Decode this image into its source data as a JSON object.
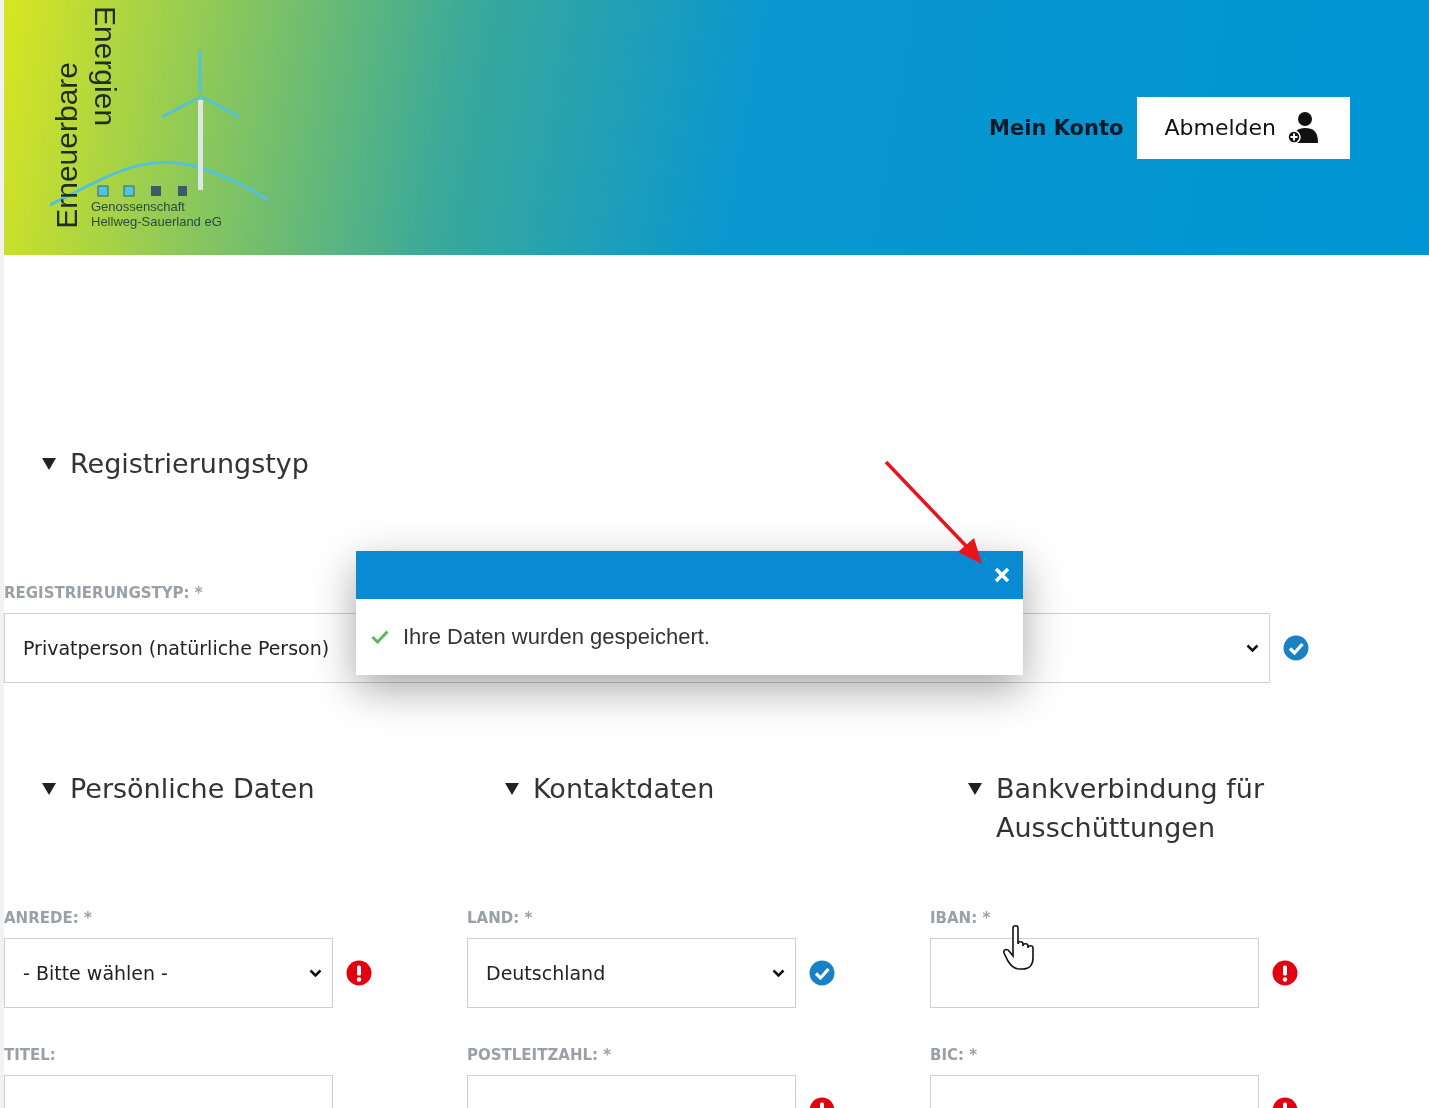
{
  "header": {
    "logo": {
      "line1": "Erneuerbare",
      "line2": "Energien",
      "subtitle_1": "Genossenschaft",
      "subtitle_2": "Hellweg-Sauerland eG"
    },
    "links": [
      {
        "label": "Mein Konto",
        "kind": "link"
      },
      {
        "label": "Abmelden",
        "kind": "button"
      }
    ]
  },
  "registration": {
    "title": "Registrierungstyp",
    "expanded": true,
    "fields": [
      {
        "label": "REGISTRIERUNGSTYP: *",
        "kind": "select",
        "value": "Privatperson (natürliche Person)",
        "valid": true,
        "error": false
      }
    ]
  },
  "columns": [
    {
      "title": "Persönliche Daten",
      "expanded": true,
      "fields": [
        {
          "label": "ANREDE: *",
          "kind": "select",
          "value": "- Bitte wählen -",
          "valid": false,
          "error": true
        },
        {
          "label": "TITEL:",
          "kind": "text",
          "valid": false,
          "error": false
        }
      ]
    },
    {
      "title": "Kontaktdaten",
      "expanded": true,
      "fields": [
        {
          "label": "LAND: *",
          "kind": "select",
          "value": "Deutschland",
          "valid": true,
          "error": false
        },
        {
          "label": "POSTLEITZAHL: *",
          "kind": "text",
          "valid": false,
          "error": true
        }
      ]
    },
    {
      "title": "Bankverbindung für Ausschüttungen",
      "expanded": true,
      "fields": [
        {
          "label": "IBAN: *",
          "kind": "text",
          "valid": false,
          "error": true
        },
        {
          "label": "BIC: *",
          "kind": "text",
          "valid": false,
          "error": true
        }
      ]
    }
  ],
  "dialog": {
    "message": "Ihre Daten wurden gespeichert."
  }
}
